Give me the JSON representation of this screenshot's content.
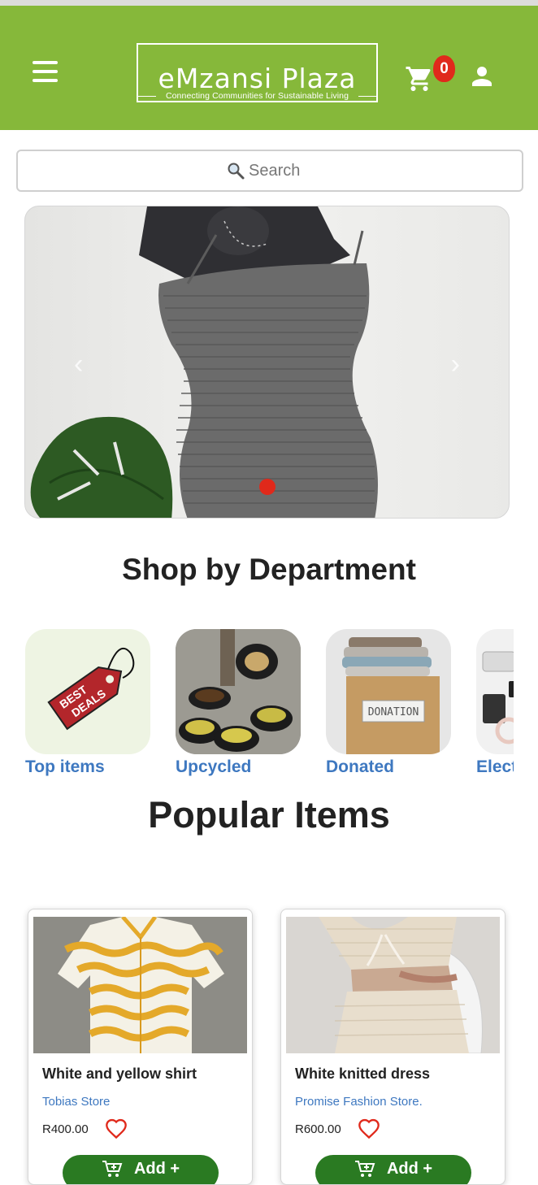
{
  "header": {
    "brand": "eMzansi Plaza",
    "tagline": "Connecting Communities for Sustainable Living",
    "cart_count": "0",
    "bg_color": "#86b83a"
  },
  "search": {
    "placeholder": "Search"
  },
  "banner": {
    "active_slide": 1
  },
  "departments": {
    "title": "Shop by Department",
    "items": [
      {
        "label": "Top items",
        "tag_text": "BEST DEALS"
      },
      {
        "label": "Upcycled"
      },
      {
        "label": "Donated",
        "box_text": "DONATION"
      },
      {
        "label": "Electronics"
      }
    ]
  },
  "popular": {
    "title": "Popular Items",
    "items": [
      {
        "name": "White and yellow shirt",
        "store": "Tobias Store",
        "price": "R400.00",
        "add_label": "Add +"
      },
      {
        "name": "White knitted dress",
        "store": "Promise Fashion Store.",
        "price": "R600.00",
        "add_label": "Add +"
      }
    ]
  },
  "colors": {
    "accent": "#86b83a",
    "badge": "#e0291b",
    "link": "#3e78c0",
    "button": "#2a7a22"
  }
}
